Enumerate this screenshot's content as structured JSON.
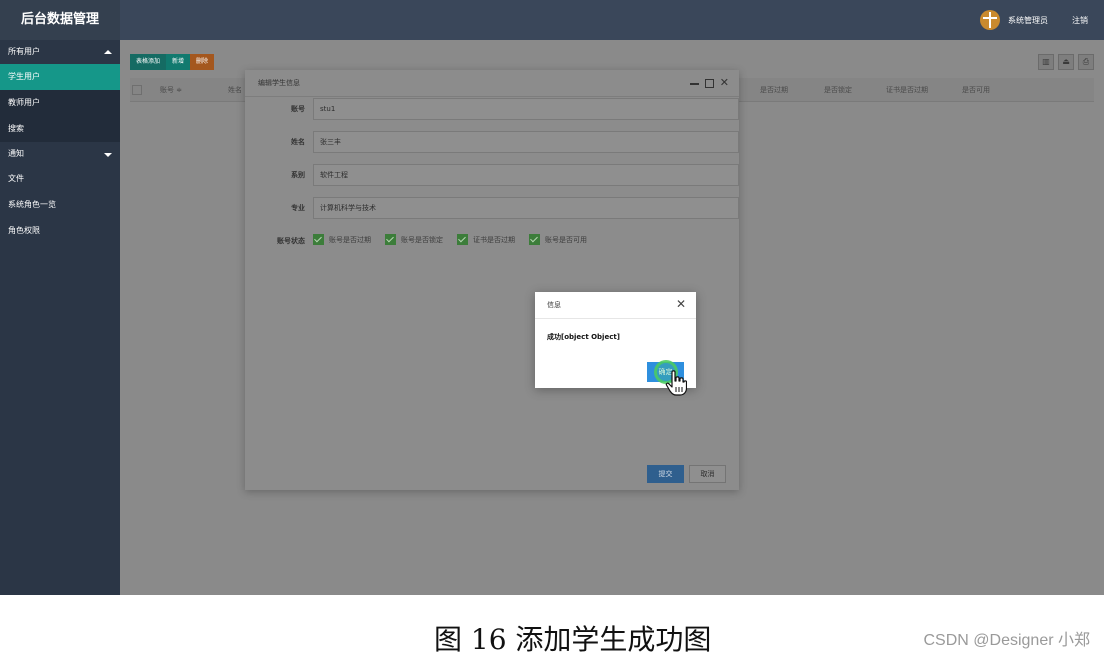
{
  "header": {
    "title": "后台数据管理",
    "user": "系统管理员",
    "logout": "注销"
  },
  "sidebar": {
    "groups": [
      {
        "label": "所有用户",
        "expanded": true
      },
      {
        "label": "通知",
        "expanded": false
      }
    ],
    "items": [
      {
        "label": "学生用户",
        "active": true
      },
      {
        "label": "教师用户"
      },
      {
        "label": "搜索"
      },
      {
        "label": "文件"
      },
      {
        "label": "系统角色一览"
      },
      {
        "label": "角色权限"
      }
    ]
  },
  "toolbar": {
    "add_table": "表格添加",
    "add": "新增",
    "delete": "删除"
  },
  "table": {
    "columns": [
      "账号 ≑",
      "姓名",
      "是否过期",
      "是否锁定",
      "证书是否过期",
      "是否可用"
    ]
  },
  "edit_dialog": {
    "title": "编辑学生信息",
    "fields": [
      {
        "label": "账号",
        "value": "stu1"
      },
      {
        "label": "姓名",
        "value": "张三丰"
      },
      {
        "label": "系别",
        "value": "软件工程"
      },
      {
        "label": "专业",
        "value": "计算机科学与技术"
      }
    ],
    "status_label": "账号状态",
    "checks": [
      "账号是否过期",
      "账号是否锁定",
      "证书是否过期",
      "账号是否可用"
    ],
    "submit": "提交",
    "cancel": "取消"
  },
  "info_dialog": {
    "title": "信息",
    "message": "成功[object Object]",
    "ok": "确定"
  },
  "caption": "图 16 添加学生成功图",
  "watermark": "CSDN @Designer 小郑",
  "colors": {
    "header": "#3a475a",
    "sidebar": "#2b3646",
    "active": "#159789",
    "primary": "#2e8fde"
  }
}
